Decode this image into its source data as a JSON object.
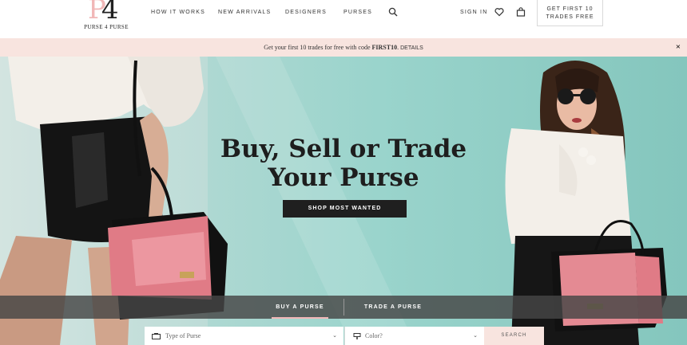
{
  "logo": {
    "mark_main": "4",
    "mark_accent": "P",
    "wordmark": "PURSE 4 PURSE"
  },
  "nav": {
    "how_it_works": "HOW IT WORKS",
    "new_arrivals": "NEW ARRIVALS",
    "designers": "DESIGNERS",
    "purses": "PURSES",
    "search_icon": "search-icon",
    "sign_in": "SIGN IN",
    "heart_icon": "heart-icon",
    "bag_icon": "bag-icon",
    "cta_line1": "GET FIRST 10",
    "cta_line2": "TRADES FREE"
  },
  "promo": {
    "text_prefix": "Get your first 10 trades for free with code ",
    "code": "FIRST10",
    "separator": ". ",
    "details": "DETAILS",
    "close": "×"
  },
  "hero": {
    "title_line1": "Buy, Sell or Trade",
    "title_line2": "Your Purse",
    "button": "SHOP MOST WANTED"
  },
  "tabs": {
    "buy": "BUY A PURSE",
    "trade": "TRADE A PURSE",
    "active": "BUY A PURSE"
  },
  "search": {
    "type_placeholder": "Type of Purse",
    "color_placeholder": "Color?",
    "button": "SEARCH",
    "chevron": "⌄"
  },
  "colors": {
    "accent_pink": "#f1b7b7",
    "promo_bg": "#f8e4df",
    "dark": "#1f1f1f"
  }
}
